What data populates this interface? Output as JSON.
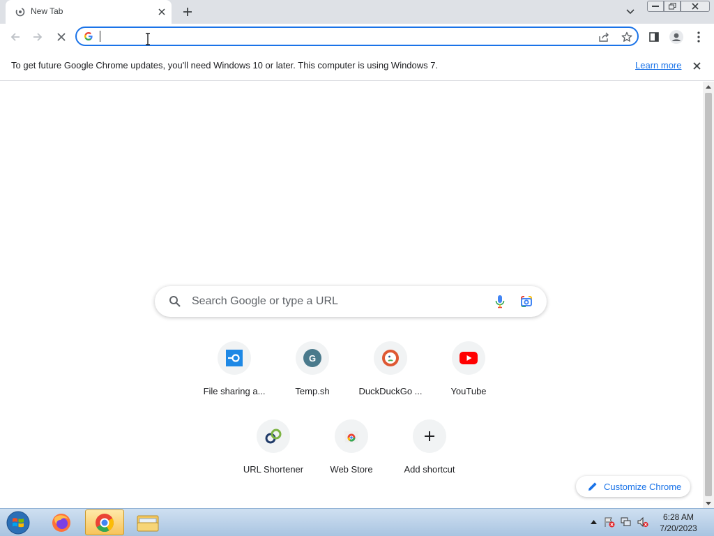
{
  "browser": {
    "tab": {
      "title": "New Tab"
    },
    "omnibox": {
      "value": "",
      "placeholder": ""
    }
  },
  "infobar": {
    "message": "To get future Google Chrome updates, you'll need Windows 10 or later. This computer is using Windows 7.",
    "link": "Learn more"
  },
  "newtab": {
    "search_placeholder": "Search Google or type a URL",
    "shortcuts": [
      {
        "label": "File sharing a...",
        "icon": "file-sharing-icon"
      },
      {
        "label": "Temp.sh",
        "icon": "temp-sh-icon"
      },
      {
        "label": "DuckDuckGo ...",
        "icon": "duckduckgo-icon"
      },
      {
        "label": "YouTube",
        "icon": "youtube-icon"
      },
      {
        "label": "URL Shortener",
        "icon": "url-shortener-icon"
      },
      {
        "label": "Web Store",
        "icon": "web-store-icon"
      },
      {
        "label": "Add shortcut",
        "icon": "plus-icon"
      }
    ],
    "customize_label": "Customize Chrome"
  },
  "taskbar": {
    "time": "6:28 AM",
    "date": "7/20/2023"
  },
  "colors": {
    "accent": "#1a73e8",
    "tabstrip": "#dee1e6",
    "youtube_red": "#ff0000"
  }
}
